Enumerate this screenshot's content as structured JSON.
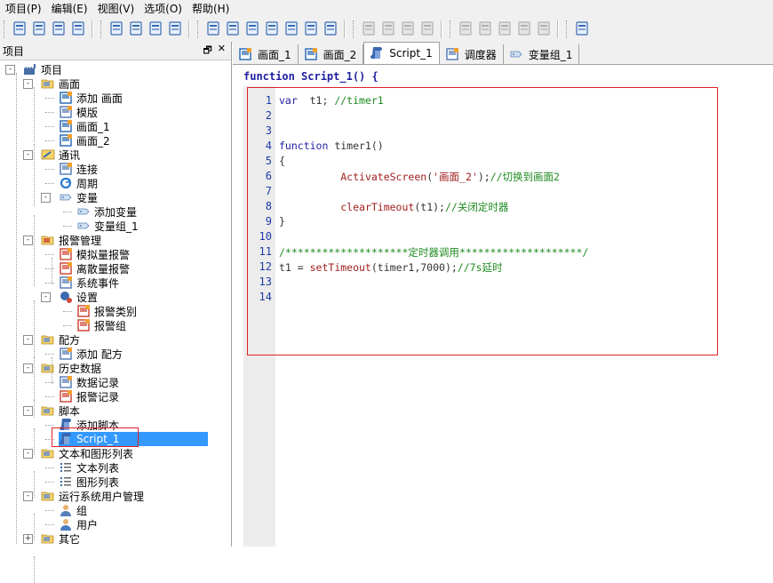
{
  "menu": [
    "项目(P)",
    "编辑(E)",
    "视图(V)",
    "选项(O)",
    "帮助(H)"
  ],
  "toolbar": {
    "buttons": [
      "new-icon",
      "open-icon",
      "save-icon",
      "print-icon",
      "grid-icon",
      "table-icon",
      "upload-icon",
      "download-icon",
      "undo-icon",
      "redo-icon",
      "cut-icon",
      "copy-icon",
      "paste-icon",
      "delete-icon",
      "find-icon",
      "cmd-c-icon",
      "cmd-f-icon",
      "cmd-sv-icon",
      "cmd-sf-icon",
      "insert-icon",
      "insert2-icon",
      "edit-icon",
      "tool-icon",
      "export-icon",
      "check-icon"
    ]
  },
  "panel": {
    "title": "项目",
    "pin": "🗗",
    "close": "✕",
    "tree": [
      {
        "label": "项目",
        "level": 0,
        "icon": "factory-icon",
        "exp": "-"
      },
      {
        "label": "画面",
        "level": 1,
        "icon": "folder-icon",
        "exp": "-"
      },
      {
        "label": "添加 画面",
        "level": 2,
        "icon": "add-screen-icon"
      },
      {
        "label": "模版",
        "level": 2,
        "icon": "template-icon"
      },
      {
        "label": "画面_1",
        "level": 2,
        "icon": "screen-icon"
      },
      {
        "label": "画面_2",
        "level": 2,
        "icon": "screen-icon"
      },
      {
        "label": "通讯",
        "level": 1,
        "icon": "comm-icon",
        "exp": "-"
      },
      {
        "label": "连接",
        "level": 2,
        "icon": "connection-icon"
      },
      {
        "label": "周期",
        "level": 2,
        "icon": "cycle-icon"
      },
      {
        "label": "变量",
        "level": 2,
        "icon": "tag-icon",
        "exp": "-"
      },
      {
        "label": "添加变量",
        "level": 3,
        "icon": "tag-add-icon"
      },
      {
        "label": "变量组_1",
        "level": 3,
        "icon": "tag-group-icon"
      },
      {
        "label": "报警管理",
        "level": 1,
        "icon": "alarm-folder-icon",
        "exp": "-"
      },
      {
        "label": "模拟量报警",
        "level": 2,
        "icon": "analog-alarm-icon"
      },
      {
        "label": "离散量报警",
        "level": 2,
        "icon": "discrete-alarm-icon"
      },
      {
        "label": "系统事件",
        "level": 2,
        "icon": "system-event-icon"
      },
      {
        "label": "设置",
        "level": 2,
        "icon": "settings-icon",
        "exp": "-"
      },
      {
        "label": "报警类别",
        "level": 3,
        "icon": "alarm-class-icon"
      },
      {
        "label": "报警组",
        "level": 3,
        "icon": "alarm-group-icon"
      },
      {
        "label": "配方",
        "level": 1,
        "icon": "recipe-folder-icon",
        "exp": "-"
      },
      {
        "label": "添加 配方",
        "level": 2,
        "icon": "recipe-add-icon"
      },
      {
        "label": "历史数据",
        "level": 1,
        "icon": "history-folder-icon",
        "exp": "-"
      },
      {
        "label": "数据记录",
        "level": 2,
        "icon": "data-log-icon"
      },
      {
        "label": "报警记录",
        "level": 2,
        "icon": "alarm-log-icon"
      },
      {
        "label": "脚本",
        "level": 1,
        "icon": "script-folder-icon",
        "exp": "-"
      },
      {
        "label": "添加脚本",
        "level": 2,
        "icon": "script-add-icon"
      },
      {
        "label": "Script_1",
        "level": 2,
        "icon": "script-icon",
        "selected": true
      },
      {
        "label": "文本和图形列表",
        "level": 1,
        "icon": "list-folder-icon",
        "exp": "-"
      },
      {
        "label": "文本列表",
        "level": 2,
        "icon": "text-list-icon"
      },
      {
        "label": "图形列表",
        "level": 2,
        "icon": "graphic-list-icon"
      },
      {
        "label": "运行系统用户管理",
        "level": 1,
        "icon": "user-folder-icon",
        "exp": "-"
      },
      {
        "label": "组",
        "level": 2,
        "icon": "group-icon"
      },
      {
        "label": "用户",
        "level": 2,
        "icon": "user-icon"
      },
      {
        "label": "其它",
        "level": 1,
        "icon": "other-folder-icon",
        "exp": "+"
      }
    ]
  },
  "tabs": [
    {
      "label": "画面_1",
      "icon": "screen-icon",
      "active": false
    },
    {
      "label": "画面_2",
      "icon": "screen-icon",
      "active": false
    },
    {
      "label": "Script_1",
      "icon": "script-icon",
      "active": true
    },
    {
      "label": "调度器",
      "icon": "scheduler-icon",
      "active": false
    },
    {
      "label": "变量组_1",
      "icon": "tag-group-icon",
      "active": false
    }
  ],
  "editor": {
    "header": "function Script_1() {",
    "lines": [
      {
        "n": "1",
        "parts": [
          [
            "kw",
            "var"
          ],
          [
            "",
            "  t1; "
          ],
          [
            "cm",
            "//timer1"
          ]
        ]
      },
      {
        "n": "2",
        "parts": []
      },
      {
        "n": "3",
        "parts": []
      },
      {
        "n": "4",
        "parts": [
          [
            "kw",
            "function"
          ],
          [
            "",
            " timer1()"
          ]
        ]
      },
      {
        "n": "5",
        "parts": [
          [
            "",
            "{"
          ]
        ]
      },
      {
        "n": "6",
        "parts": [
          [
            "",
            "          "
          ],
          [
            "fn",
            "ActivateScreen"
          ],
          [
            "",
            "("
          ],
          [
            "st",
            "'画面_2'"
          ],
          [
            "",
            ");"
          ],
          [
            "cm",
            "//切换到画面2"
          ]
        ]
      },
      {
        "n": "7",
        "parts": []
      },
      {
        "n": "8",
        "parts": [
          [
            "",
            "          "
          ],
          [
            "fn",
            "clearTimeout"
          ],
          [
            "",
            "(t1);"
          ],
          [
            "cm",
            "//关闭定时器"
          ]
        ]
      },
      {
        "n": "9",
        "parts": [
          [
            "",
            "}"
          ]
        ]
      },
      {
        "n": "10",
        "parts": []
      },
      {
        "n": "11",
        "parts": [
          [
            "cm",
            "/********************定时器调用********************/"
          ]
        ]
      },
      {
        "n": "12",
        "parts": [
          [
            "",
            "t1 = "
          ],
          [
            "fn",
            "setTimeout"
          ],
          [
            "",
            "(timer1,7000);"
          ],
          [
            "cm",
            "//7s延时"
          ]
        ]
      },
      {
        "n": "13",
        "parts": []
      },
      {
        "n": "14",
        "parts": []
      }
    ]
  }
}
